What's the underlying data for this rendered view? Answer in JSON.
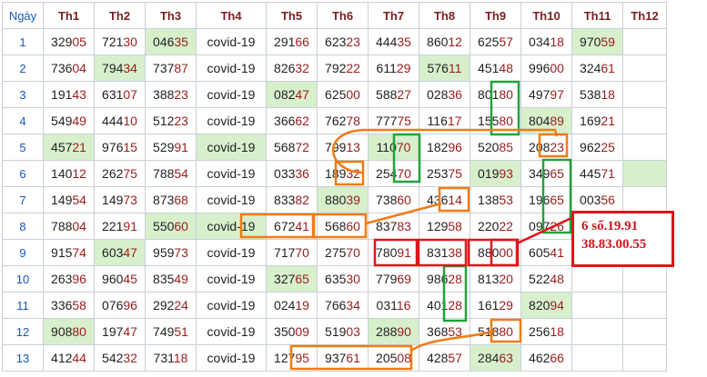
{
  "headers": [
    "Ngày",
    "Th1",
    "Th2",
    "Th3",
    "Th4",
    "Th5",
    "Th6",
    "Th7",
    "Th8",
    "Th9",
    "Th10",
    "Th11",
    "Th12"
  ],
  "rows": [
    {
      "day": "1",
      "cells": [
        "32905",
        "72130",
        "04635",
        "covid-19",
        "29166",
        "62323",
        "44435",
        "86012",
        "62557",
        "03418",
        "97059",
        ""
      ],
      "green": [
        2,
        10
      ]
    },
    {
      "day": "2",
      "cells": [
        "73604",
        "79434",
        "73787",
        "covid-19",
        "82632",
        "79222",
        "61129",
        "57611",
        "45148",
        "99600",
        "32461",
        ""
      ],
      "green": [
        1,
        7
      ]
    },
    {
      "day": "3",
      "cells": [
        "19143",
        "63107",
        "38823",
        "covid-19",
        "08247",
        "62500",
        "58827",
        "02836",
        "80180",
        "49797",
        "53818",
        ""
      ],
      "green": [
        4
      ]
    },
    {
      "day": "4",
      "cells": [
        "54949",
        "44410",
        "51223",
        "covid-19",
        "36662",
        "76278",
        "77775",
        "11617",
        "15580",
        "80489",
        "16921",
        ""
      ],
      "green": [
        9
      ]
    },
    {
      "day": "5",
      "cells": [
        "45721",
        "97615",
        "52991",
        "covid-19",
        "56872",
        "79913",
        "11070",
        "18296",
        "52085",
        "20823",
        "96225",
        ""
      ],
      "green": [
        0,
        3,
        6
      ]
    },
    {
      "day": "6",
      "cells": [
        "14012",
        "26275",
        "78854",
        "covid-19",
        "03336",
        "18932",
        "25470",
        "25375",
        "01993",
        "34965",
        "44571",
        ""
      ],
      "green": [
        8,
        11
      ]
    },
    {
      "day": "7",
      "cells": [
        "14954",
        "14973",
        "87368",
        "covid-19",
        "83382",
        "88039",
        "73860",
        "43614",
        "13853",
        "19665",
        "00356",
        ""
      ],
      "green": [
        5
      ]
    },
    {
      "day": "8",
      "cells": [
        "78804",
        "22191",
        "55060",
        "covid-19",
        "67241",
        "56860",
        "83783",
        "12958",
        "22022",
        "09726",
        "",
        ""
      ],
      "green": [
        2,
        3
      ]
    },
    {
      "day": "9",
      "cells": [
        "91574",
        "60347",
        "95973",
        "covid-19",
        "71770",
        "27570",
        "78091",
        "83138",
        "88000",
        "60541",
        "",
        ""
      ],
      "green": [
        1
      ]
    },
    {
      "day": "10",
      "cells": [
        "26396",
        "96045",
        "83549",
        "covid-19",
        "32765",
        "63530",
        "77969",
        "98628",
        "81320",
        "52248",
        "",
        ""
      ],
      "green": [
        4
      ]
    },
    {
      "day": "11",
      "cells": [
        "33658",
        "07696",
        "29224",
        "covid-19",
        "02419",
        "76634",
        "03116",
        "40128",
        "16129",
        "82094",
        "",
        ""
      ],
      "green": [
        9
      ]
    },
    {
      "day": "12",
      "cells": [
        "90880",
        "19747",
        "74951",
        "covid-19",
        "35009",
        "51903",
        "28890",
        "36853",
        "51880",
        "25618",
        "",
        ""
      ],
      "green": [
        0,
        6
      ]
    },
    {
      "day": "13",
      "cells": [
        "41244",
        "54232",
        "73118",
        "covid-19",
        "12795",
        "93761",
        "20508",
        "42857",
        "28463",
        "46266",
        "",
        ""
      ],
      "green": [
        8
      ]
    }
  ],
  "callout": {
    "line1": "6 số.19.91",
    "line2": "38.83.00.55"
  },
  "colors": {
    "green_cell": "#d8efcc",
    "orange_box": "#f07b14",
    "green_box": "#22a33a",
    "red_box": "#e0141b",
    "header_text": "#7a1f1f",
    "day_text": "#1a56b8"
  }
}
